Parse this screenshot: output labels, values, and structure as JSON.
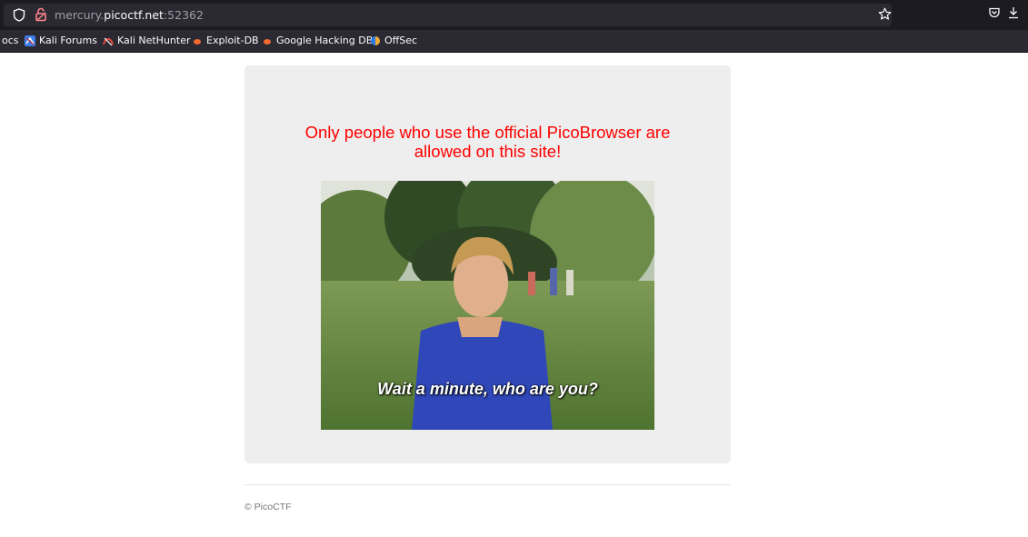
{
  "browser": {
    "url_prefix": "mercury.",
    "url_host": "picoctf.net",
    "url_port": ":52362"
  },
  "bookmarks": [
    {
      "label": "ocs"
    },
    {
      "label": "Kali Forums"
    },
    {
      "label": "Kali NetHunter"
    },
    {
      "label": "Exploit-DB"
    },
    {
      "label": "Google Hacking DB"
    },
    {
      "label": "OffSec"
    }
  ],
  "page": {
    "warning_line1": "Only people who use the official PicoBrowser are",
    "warning_line2": "allowed on this site!",
    "gif_caption": "Wait a minute, who are you?",
    "footer": "© PicoCTF"
  },
  "colors": {
    "warning": "#ff0000",
    "panel": "#eeeeee"
  }
}
